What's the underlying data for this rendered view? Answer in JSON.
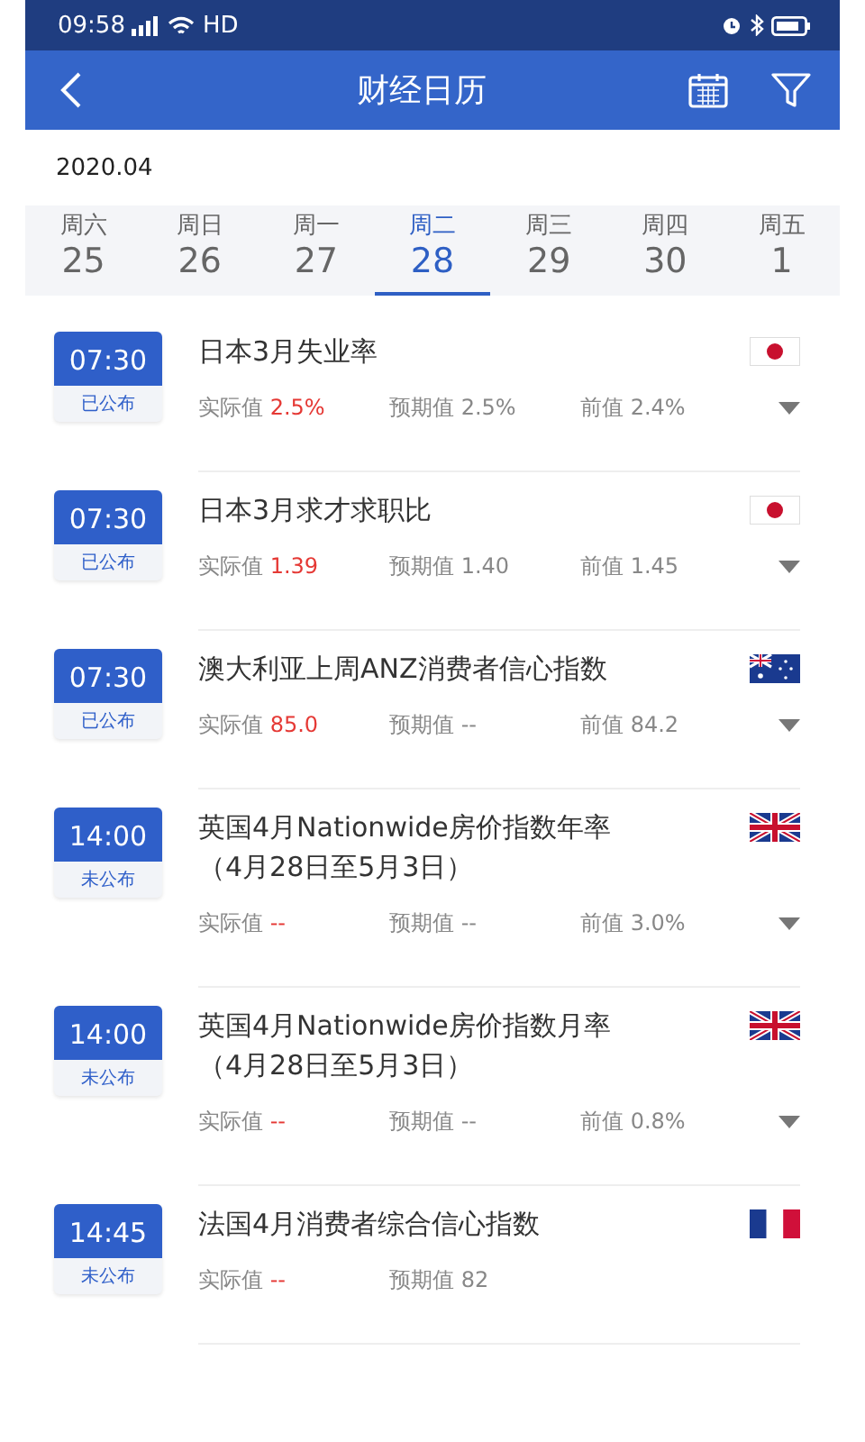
{
  "status_bar": {
    "time": "09:58",
    "network": "HD"
  },
  "header": {
    "title": "财经日历"
  },
  "month": "2020.04",
  "days": [
    {
      "weekday": "周六",
      "date": "25",
      "selected": false
    },
    {
      "weekday": "周日",
      "date": "26",
      "selected": false
    },
    {
      "weekday": "周一",
      "date": "27",
      "selected": false
    },
    {
      "weekday": "周二",
      "date": "28",
      "selected": true
    },
    {
      "weekday": "周三",
      "date": "29",
      "selected": false
    },
    {
      "weekday": "周四",
      "date": "30",
      "selected": false
    },
    {
      "weekday": "周五",
      "date": "1",
      "selected": false
    }
  ],
  "events": [
    {
      "time": "07:30",
      "status": "已公布",
      "title": "日本3月失业率",
      "flag": {
        "kind": "jp"
      },
      "actual_label": "实际值",
      "actual": "2.5%",
      "forecast": "预期值 2.5%",
      "previous": "前值 2.4%"
    },
    {
      "time": "07:30",
      "status": "已公布",
      "title": "日本3月求才求职比",
      "flag": {
        "kind": "jp"
      },
      "actual_label": "实际值",
      "actual": "1.39",
      "forecast": "预期值 1.40",
      "previous": "前值 1.45"
    },
    {
      "time": "07:30",
      "status": "已公布",
      "title": "澳大利亚上周ANZ消费者信心指数",
      "flag": {
        "kind": "au"
      },
      "actual_label": "实际值",
      "actual": "85.0",
      "forecast": "预期值 --",
      "previous": "前值 84.2"
    },
    {
      "time": "14:00",
      "status": "未公布",
      "title": "英国4月Nationwide房价指数年率（4月28日至5月3日）",
      "flag": {
        "kind": "gb"
      },
      "actual_label": "实际值",
      "actual": "--",
      "forecast": "预期值 --",
      "previous": "前值 3.0%"
    },
    {
      "time": "14:00",
      "status": "未公布",
      "title": "英国4月Nationwide房价指数月率（4月28日至5月3日）",
      "flag": {
        "kind": "gb"
      },
      "actual_label": "实际值",
      "actual": "--",
      "forecast": "预期值 --",
      "previous": "前值 0.8%"
    },
    {
      "time": "14:45",
      "status": "未公布",
      "title": "法国4月消费者综合信心指数",
      "flag": {
        "kind": "fr"
      },
      "actual_label": "实际值",
      "actual": "--",
      "forecast": "预期值 82"
    }
  ]
}
